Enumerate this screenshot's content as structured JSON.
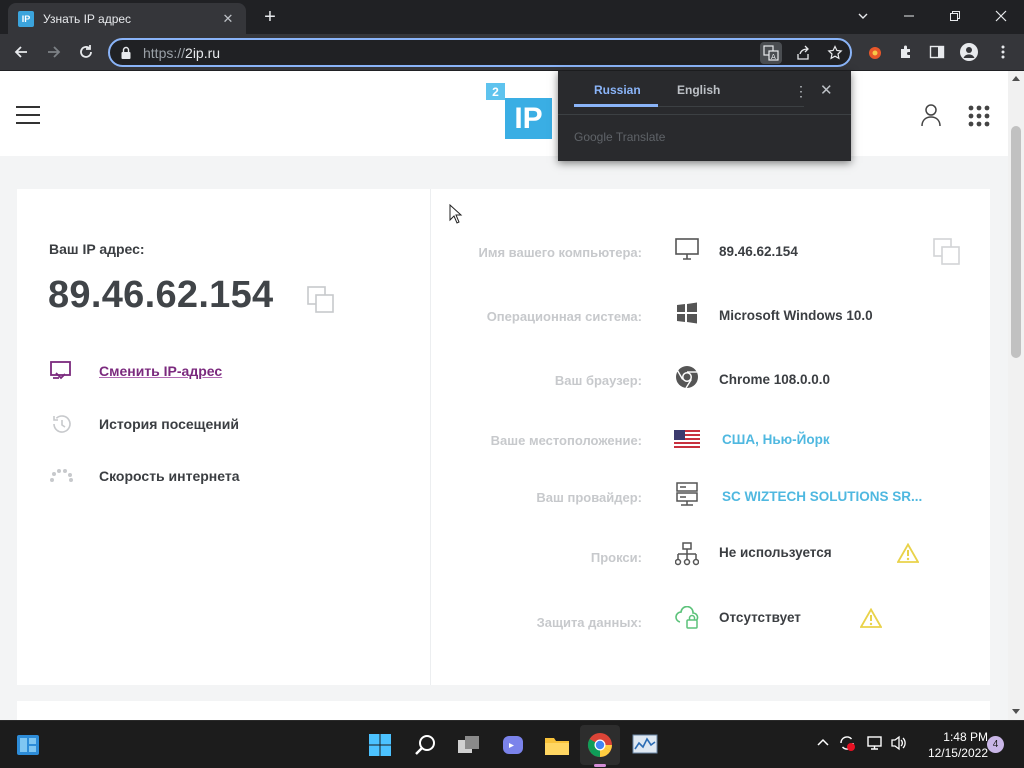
{
  "browser": {
    "tab": {
      "title": "Узнать IP адрес",
      "favicon_text": "IP"
    },
    "url": {
      "scheme": "https://",
      "host": "2ip.ru"
    },
    "icons": [
      "back-icon",
      "forward-icon",
      "reload-icon",
      "lock-icon",
      "translate-icon",
      "share-icon",
      "star-icon",
      "extension-icon",
      "puzzle-icon",
      "sidepanel-icon",
      "profile-icon",
      "kebab-menu-icon"
    ]
  },
  "translate_popup": {
    "tab_source": "Russian",
    "tab_target": "English",
    "brand": "Google Translate"
  },
  "site": {
    "logo_big": "IP",
    "logo_small": "2",
    "left": {
      "ip_label": "Ваш IP адрес:",
      "ip_value": "89.46.62.154",
      "menu": [
        {
          "label": "Сменить IP-адрес"
        },
        {
          "label": "История посещений"
        },
        {
          "label": "Скорость интернета"
        }
      ]
    },
    "rows": [
      {
        "label": "Имя вашего компьютера:",
        "value": "89.46.62.154"
      },
      {
        "label": "Операционная система:",
        "value": "Microsoft Windows 10.0"
      },
      {
        "label": "Ваш браузер:",
        "value": "Chrome 108.0.0.0"
      },
      {
        "label": "Ваше местоположение:",
        "value": "США, Нью-Йорк"
      },
      {
        "label": "Ваш провайдер:",
        "value": "SC WIZTECH SOLUTIONS SR..."
      },
      {
        "label": "Прокси:",
        "value": "Не используется"
      },
      {
        "label": "Защита данных:",
        "value": "Отсутствует"
      }
    ],
    "colors": {
      "accent_blue": "#3aaee4",
      "link_purple": "#7b2a7e",
      "warning_yellow": "#e9d24a"
    }
  },
  "taskbar": {
    "time": "1:48 PM",
    "date": "12/15/2022",
    "notifications": "4"
  }
}
